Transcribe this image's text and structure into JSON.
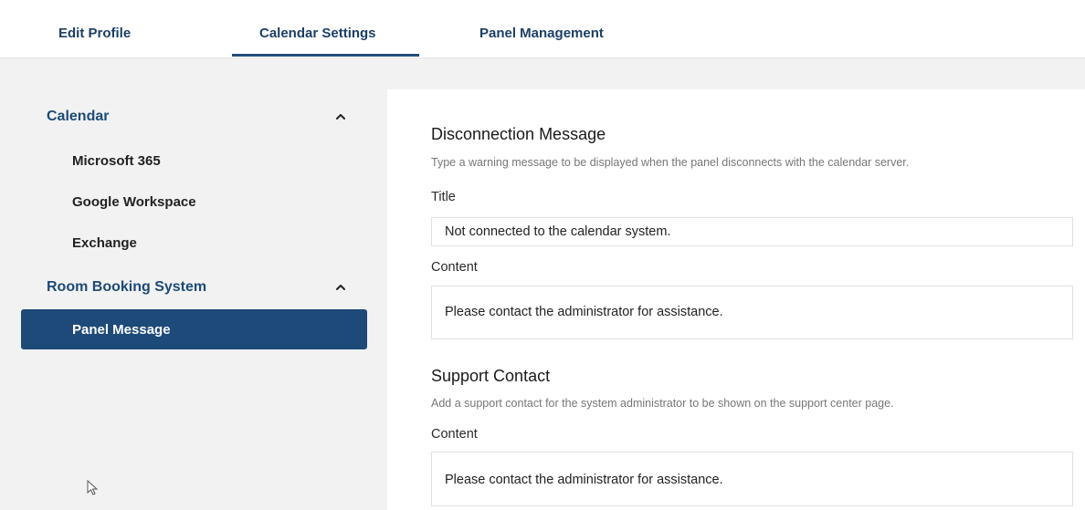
{
  "tabs": [
    {
      "label": "Edit Profile"
    },
    {
      "label": "Calendar Settings"
    },
    {
      "label": "Panel Management"
    }
  ],
  "sidebar": {
    "groups": [
      {
        "label": "Calendar",
        "items": [
          "Microsoft 365",
          "Google Workspace",
          "Exchange"
        ]
      },
      {
        "label": "Room Booking System",
        "items": [
          "Panel Message"
        ]
      }
    ]
  },
  "disconnection": {
    "title": "Disconnection Message",
    "description": "Type a warning message to be displayed when the panel disconnects with the calendar server.",
    "title_label": "Title",
    "title_value": "Not connected to the calendar system.",
    "content_label": "Content",
    "content_value": "Please contact the administrator for assistance."
  },
  "support": {
    "title": "Support Contact",
    "description": "Add a support contact for the system administrator to be shown on the support center page.",
    "content_label": "Content",
    "content_value": "Please contact the administrator for assistance."
  },
  "colors": {
    "accent": "#1d4a78",
    "background": "#f2f2f2"
  }
}
